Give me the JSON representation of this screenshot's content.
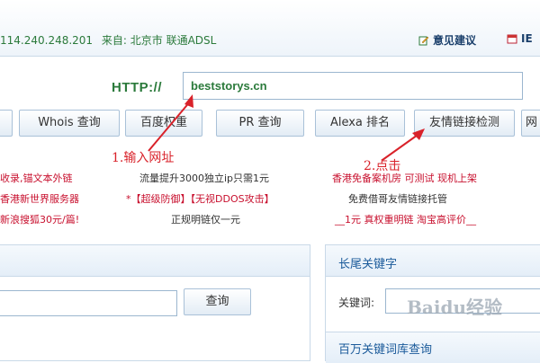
{
  "topbar": {
    "ip_text": "114.240.248.201",
    "location_text": "来自: 北京市 联通ADSL",
    "feedback_label": "意见建议",
    "ie_label": "IE"
  },
  "url_bar": {
    "label": "HTTP://",
    "value": "beststorys.cn"
  },
  "tools": [
    {
      "label": "Whois 查询"
    },
    {
      "label": "百度权重"
    },
    {
      "label": "PR 查询"
    },
    {
      "label": "Alexa 排名"
    },
    {
      "label": "友情链接检测"
    },
    {
      "label": "网"
    }
  ],
  "annotations": {
    "step1": "1.输入网址",
    "step2": "2.点击"
  },
  "ads": {
    "col1": [
      "收录,锚文本外链",
      "香港新世界服务器",
      "新浪搜狐30元/篇!"
    ],
    "col2": [
      "流量提升3000独立ip只需1元",
      "*【超级防御】【无视DDOS攻击】",
      "正规明链仅一元"
    ],
    "col3": [
      "香港免备案机房 可测试 现机上架",
      "免费借哥友情链接托管",
      "__1元 真权重明链 淘宝高评价__"
    ]
  },
  "left_panel": {
    "query_button_label": "查询"
  },
  "right_panel": {
    "title": "长尾关键字",
    "keyword_label": "关键词:",
    "bottom_title": "百万关键词库查询"
  },
  "watermark": "Baidu经验",
  "colors": {
    "green_text": "#2b7a3b",
    "annotation_red": "#d9222a",
    "ad_red": "#c8102e",
    "border_blue": "#a9c1d8"
  }
}
